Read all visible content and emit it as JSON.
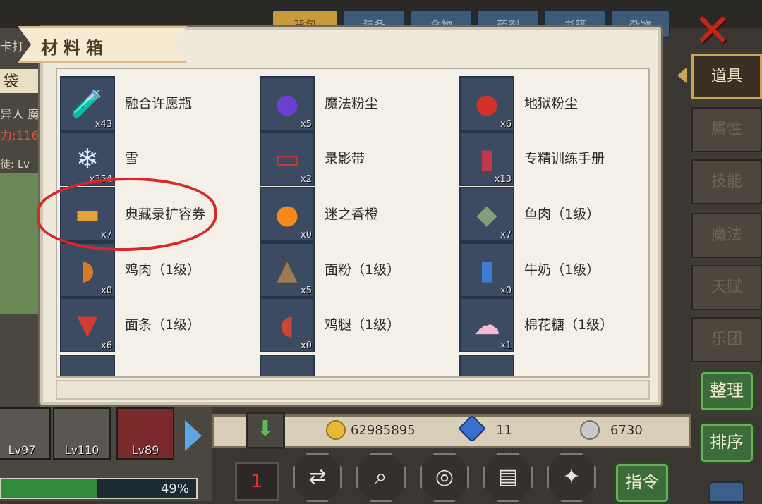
{
  "background": {
    "tabs": [
      "背包",
      "装备",
      "食物",
      "药剂",
      "书籍",
      "杂物"
    ],
    "left_card": "袋",
    "left_lines": [
      "卡打",
      "异人 魔",
      "力:116",
      "徒: Lv"
    ],
    "close_icon": "close-x-icon"
  },
  "modal": {
    "title": "材料箱",
    "items": [
      {
        "name": "融合许愿瓶",
        "qty": "x43",
        "icon": "potion-bottle-icon",
        "color": "#b7d3e8"
      },
      {
        "name": "魔法粉尘",
        "qty": "x5",
        "icon": "purple-orb-icon",
        "color": "#6b3fd4"
      },
      {
        "name": "地狱粉尘",
        "qty": "x6",
        "icon": "red-orb-icon",
        "color": "#d1322c"
      },
      {
        "name": "雪",
        "qty": "x354",
        "icon": "snowball-icon",
        "color": "#dfeffd"
      },
      {
        "name": "录影带",
        "qty": "x2",
        "icon": "cassette-tape-icon",
        "color": "#c43a3a"
      },
      {
        "name": "专精训练手册",
        "qty": "x13",
        "icon": "manual-book-icon",
        "color": "#c0394a"
      },
      {
        "name": "典藏录扩容券",
        "qty": "x7",
        "icon": "ticket-icon",
        "color": "#e2a33a"
      },
      {
        "name": "迷之香橙",
        "qty": "x0",
        "icon": "orange-icon",
        "color": "#f28a1c"
      },
      {
        "name": "鱼肉（1级）",
        "qty": "x7",
        "icon": "fish-icon",
        "color": "#7fa07a"
      },
      {
        "name": "鸡肉（1级）",
        "qty": "x0",
        "icon": "chicken-icon",
        "color": "#d77b2a"
      },
      {
        "name": "面粉（1级）",
        "qty": "x5",
        "icon": "flour-sack-icon",
        "color": "#a07a4c"
      },
      {
        "name": "牛奶（1级）",
        "qty": "x0",
        "icon": "milk-carton-icon",
        "color": "#3c7fd2"
      },
      {
        "name": "面条（1级）",
        "qty": "x6",
        "icon": "noodles-icon",
        "color": "#d43b2f"
      },
      {
        "name": "鸡腿（1级）",
        "qty": "x0",
        "icon": "drumstick-icon",
        "color": "#c8473a"
      },
      {
        "name": "棉花糖（1级）",
        "qty": "x1",
        "icon": "cotton-candy-icon",
        "color": "#f4b9d6"
      }
    ]
  },
  "side_tabs": [
    "道具",
    "属性",
    "技能",
    "魔法",
    "天赋",
    "乐团"
  ],
  "side_buttons": {
    "sort_label": "整理",
    "order_label": "排序",
    "command_label": "指令"
  },
  "resources": {
    "gold": "62985895",
    "gem": "11",
    "silver": "6730"
  },
  "heroes": [
    {
      "lv": "Lv97"
    },
    {
      "lv": "Lv110"
    },
    {
      "lv": "Lv89"
    }
  ],
  "progress": {
    "text": "49%",
    "value": 0.49
  },
  "annotation_color": "#d8262a"
}
